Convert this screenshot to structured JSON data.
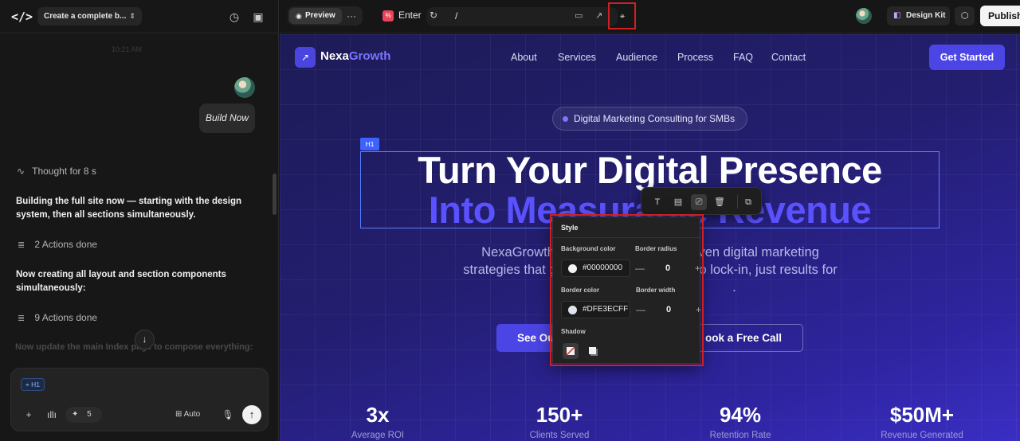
{
  "sidebar": {
    "project_title": "Create a complete b...",
    "faded_timestamp": "10:21 AM",
    "user_message": "Build Now",
    "thought": "Thought for 8 s",
    "messages": [
      "Building the full site now — starting with the design system, then all sections simultaneously.",
      "Now creating all layout and section components simultaneously:"
    ],
    "actions": [
      "2 Actions done",
      "9 Actions done"
    ],
    "faded_message": "Now update the main Index page to compose everything:",
    "composer": {
      "chip": "H1",
      "credits": "5",
      "mode": "Auto"
    }
  },
  "topbar": {
    "preview_label": "Preview",
    "page_name": "Enter",
    "url_path": "/",
    "design_kit_label": "Design Kit",
    "publish_label": "Publish"
  },
  "site": {
    "brand_primary": "Nexa",
    "brand_accent": "Growth",
    "nav": [
      "About",
      "Services",
      "Audience",
      "Process",
      "FAQ",
      "Contact"
    ],
    "cta": "Get Started",
    "badge": "Digital Marketing Consulting for SMBs",
    "h1_tag": "H1",
    "hero_line1": "Turn Your Digital Presence",
    "hero_line2": "Into Measurable Revenue",
    "subtitle_line1": "NexaGrowth C                                   iven digital marketing",
    "subtitle_line2": "strategies that gen                                 no lock-in, just results for",
    "subtitle_line3": "                                              .",
    "btn_primary": "See Ou",
    "btn_secondary": "ook a Free Call",
    "stats": [
      {
        "value": "3x",
        "label": "Average ROI"
      },
      {
        "value": "150+",
        "label": "Clients Served"
      },
      {
        "value": "94%",
        "label": "Retention Rate"
      },
      {
        "value": "$50M+",
        "label": "Revenue Generated"
      }
    ]
  },
  "style_panel": {
    "title": "Style",
    "background_color_label": "Background color",
    "background_color_value": "#00000000",
    "border_radius_label": "Border radius",
    "border_radius_value": "0",
    "border_color_label": "Border color",
    "border_color_value": "#DFE3ECFF",
    "border_width_label": "Border width",
    "border_width_value": "0",
    "shadow_label": "Shadow"
  },
  "colors": {
    "accent": "#4b45e6",
    "highlight_red": "#d21f22",
    "selection_blue": "#3d62ff"
  }
}
